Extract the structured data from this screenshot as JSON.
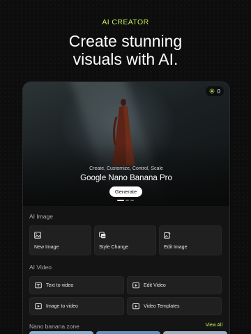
{
  "promo": {
    "eyebrow": "AI CREATOR",
    "headline_line1": "Create stunning",
    "headline_line2": "visuals with AI."
  },
  "hero": {
    "credits": "0",
    "subtitle": "Create, Customize, Control, Scale",
    "title": "Google Nano Banana Pro",
    "button": "Generate",
    "slides_total": 3,
    "active_slide": 1
  },
  "ai_image": {
    "label": "AI Image",
    "items": [
      {
        "label": "New Image",
        "icon": "image-icon"
      },
      {
        "label": "Style Change",
        "icon": "style-icon"
      },
      {
        "label": "Edit Image",
        "icon": "edit-image-icon"
      }
    ]
  },
  "ai_video": {
    "label": "AI Video",
    "items": [
      {
        "label": "Text to video",
        "icon": "text-video-icon"
      },
      {
        "label": "Edit Video",
        "icon": "edit-video-icon"
      },
      {
        "label": "Image to video",
        "icon": "image-video-icon"
      },
      {
        "label": "Video Templates",
        "icon": "template-icon"
      }
    ]
  },
  "nano_zone": {
    "label": "Nano banana zone",
    "view_all": "View All"
  },
  "colors": {
    "accent": "#c6f05a",
    "background": "#0c0d0c",
    "tile": "#1f201f"
  }
}
